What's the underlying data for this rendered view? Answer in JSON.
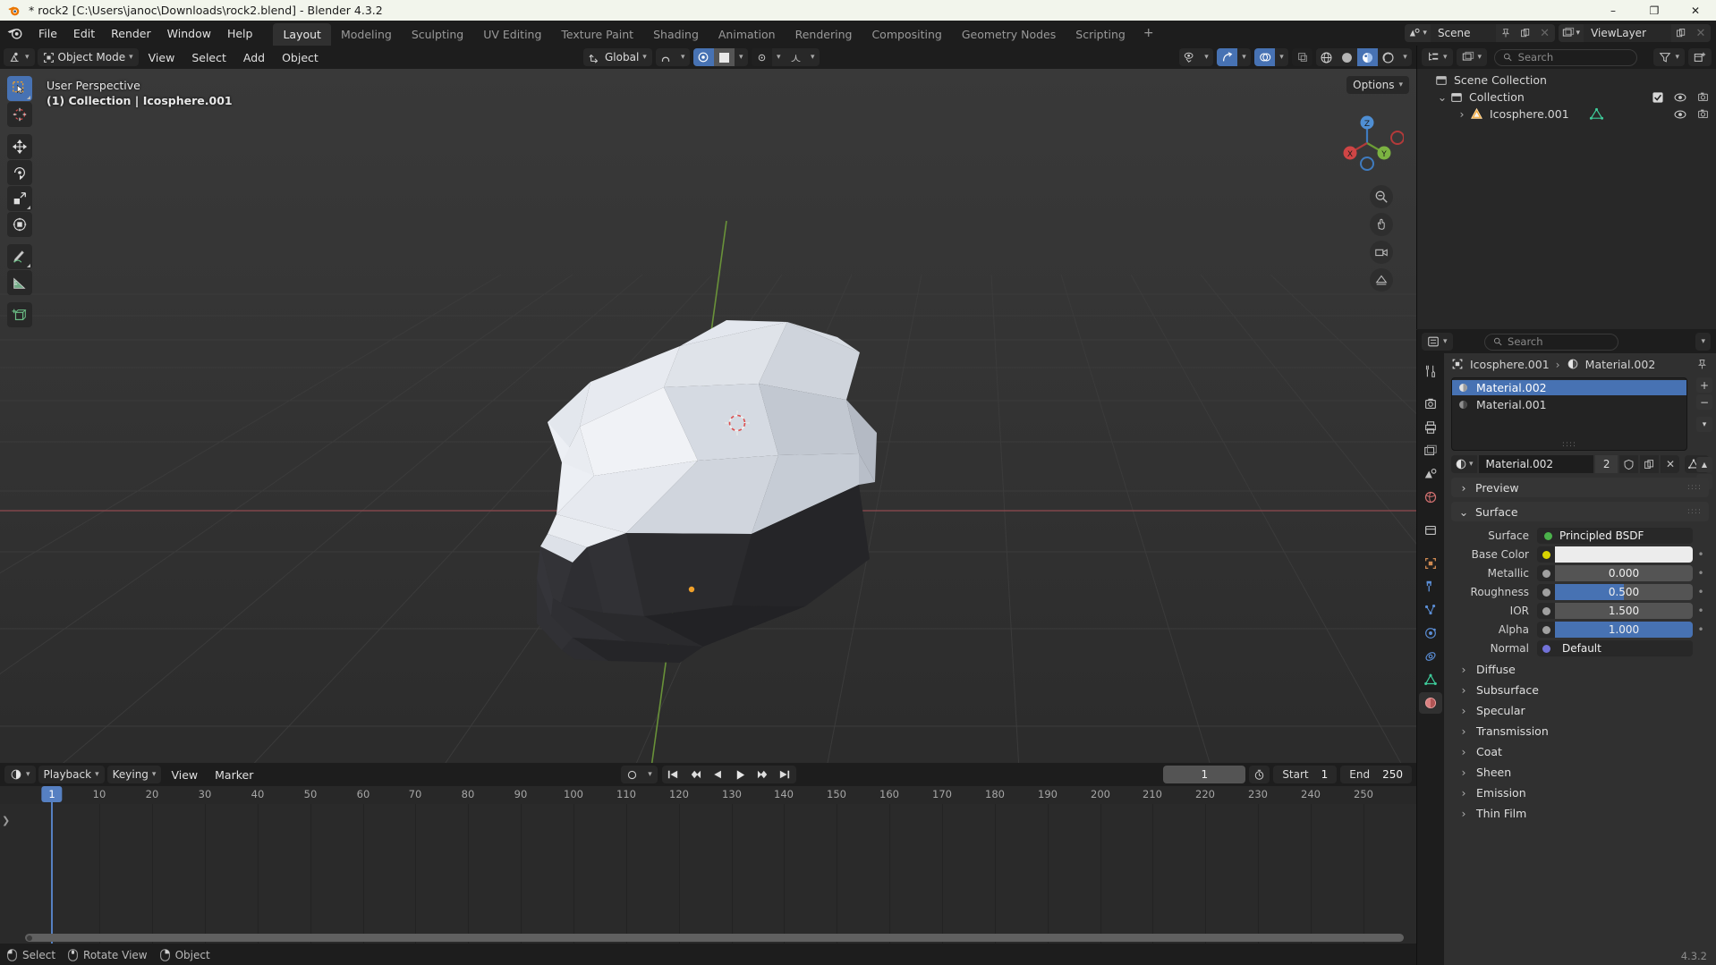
{
  "window": {
    "title": "* rock2 [C:\\Users\\janoc\\Downloads\\rock2.blend] - Blender 4.3.2",
    "minimize": "–",
    "maximize": "❐",
    "close": "✕"
  },
  "topbar": {
    "menus": [
      "File",
      "Edit",
      "Render",
      "Window",
      "Help"
    ],
    "workspaces": [
      {
        "label": "Layout",
        "active": true
      },
      {
        "label": "Modeling",
        "active": false
      },
      {
        "label": "Sculpting",
        "active": false
      },
      {
        "label": "UV Editing",
        "active": false
      },
      {
        "label": "Texture Paint",
        "active": false
      },
      {
        "label": "Shading",
        "active": false
      },
      {
        "label": "Animation",
        "active": false
      },
      {
        "label": "Rendering",
        "active": false
      },
      {
        "label": "Compositing",
        "active": false
      },
      {
        "label": "Geometry Nodes",
        "active": false
      },
      {
        "label": "Scripting",
        "active": false
      }
    ],
    "add_workspace": "+",
    "scene_name": "Scene",
    "viewlayer_name": "ViewLayer"
  },
  "viewport": {
    "mode": "Object Mode",
    "menus": [
      "View",
      "Select",
      "Add",
      "Object"
    ],
    "transform_orientation": "Global",
    "options_label": "Options",
    "info_line1": "User Perspective",
    "info_line2": "(1) Collection | Icosphere.001",
    "tools": [
      "tweak-select-tool",
      "cursor-tool",
      "move-tool",
      "rotate-tool",
      "scale-tool",
      "transform-tool",
      "annotate-tool",
      "measure-tool",
      "add-cube-tool"
    ],
    "gizmo_axes": {
      "x": "X",
      "y": "Y",
      "z": "Z"
    }
  },
  "outliner": {
    "search_placeholder": "Search",
    "rows": [
      {
        "label": "Scene Collection",
        "indent": 0,
        "icon": "collection-icon",
        "chevron": "",
        "checkbox": false,
        "eye": false,
        "camera": false
      },
      {
        "label": "Collection",
        "indent": 1,
        "icon": "collection-icon",
        "chevron": "⌄",
        "checkbox": true,
        "eye": true,
        "camera": true
      },
      {
        "label": "Icosphere.001",
        "indent": 2,
        "icon": "mesh-object-icon",
        "chevron": "›",
        "checkbox": false,
        "eye": true,
        "camera": true
      }
    ]
  },
  "properties": {
    "search_placeholder": "Search",
    "breadcrumb_object": "Icosphere.001",
    "breadcrumb_sep": "›",
    "breadcrumb_material": "Material.002",
    "material_slots": [
      {
        "name": "Material.002",
        "selected": true
      },
      {
        "name": "Material.001",
        "selected": false
      }
    ],
    "material_id": {
      "name": "Material.002",
      "users": "2"
    },
    "panels": [
      {
        "label": "Preview",
        "open": false
      },
      {
        "label": "Surface",
        "open": true
      }
    ],
    "surface": {
      "shader_label": "Surface",
      "shader_value": "Principled BSDF",
      "rows": [
        {
          "label": "Base Color",
          "value": "",
          "type": "color",
          "color": "#ececec",
          "socket": "#d9d400"
        },
        {
          "label": "Metallic",
          "value": "0.000",
          "type": "slider",
          "fill": 0,
          "socket": "#a0a0a0"
        },
        {
          "label": "Roughness",
          "value": "0.500",
          "type": "slider",
          "fill": 50,
          "socket": "#a0a0a0"
        },
        {
          "label": "IOR",
          "value": "1.500",
          "type": "slider",
          "fill": 0,
          "socket": "#a0a0a0"
        },
        {
          "label": "Alpha",
          "value": "1.000",
          "type": "slider",
          "fill": 100,
          "socket": "#a0a0a0"
        },
        {
          "label": "Normal",
          "value": "Default",
          "type": "link",
          "socket": "#7272d8"
        }
      ]
    },
    "sub_panels": [
      "Diffuse",
      "Subsurface",
      "Specular",
      "Transmission",
      "Coat",
      "Sheen",
      "Emission",
      "Thin Film"
    ],
    "tabs": [
      {
        "name": "tool-tab",
        "active": false
      },
      {
        "name": "render-tab",
        "active": false
      },
      {
        "name": "output-tab",
        "active": false
      },
      {
        "name": "view-layer-tab",
        "active": false
      },
      {
        "name": "scene-tab",
        "active": false
      },
      {
        "name": "world-tab",
        "active": false
      },
      {
        "name": "collection-tab",
        "active": false
      },
      {
        "name": "object-tab",
        "active": false
      },
      {
        "name": "modifiers-tab",
        "active": false
      },
      {
        "name": "particles-tab",
        "active": false
      },
      {
        "name": "physics-tab",
        "active": false
      },
      {
        "name": "constraints-tab",
        "active": false
      },
      {
        "name": "object-data-tab",
        "active": false
      },
      {
        "name": "material-tab",
        "active": true
      }
    ]
  },
  "timeline": {
    "menus": [
      "Playback",
      "Keying",
      "View",
      "Marker"
    ],
    "current_frame": "1",
    "start_label": "Start",
    "start_value": "1",
    "end_label": "End",
    "end_value": "250",
    "playhead_frame": "1",
    "ticks": [
      "10",
      "20",
      "30",
      "40",
      "50",
      "60",
      "70",
      "80",
      "90",
      "100",
      "110",
      "120",
      "130",
      "140",
      "150",
      "160",
      "170",
      "180",
      "190",
      "200",
      "210",
      "220",
      "230",
      "240",
      "250"
    ]
  },
  "statusbar": {
    "items": [
      {
        "label": "Select",
        "icon": "mouse-left-icon"
      },
      {
        "label": "Rotate View",
        "icon": "mouse-middle-icon"
      },
      {
        "label": "Object",
        "icon": "mouse-right-icon"
      }
    ],
    "version": "4.3.2"
  },
  "colors": {
    "accent_blue": "#4772b3",
    "playhead": "#5680c2",
    "panel_bg": "#303030",
    "header_bg": "#1d1d1d",
    "field_bg": "#545454"
  }
}
